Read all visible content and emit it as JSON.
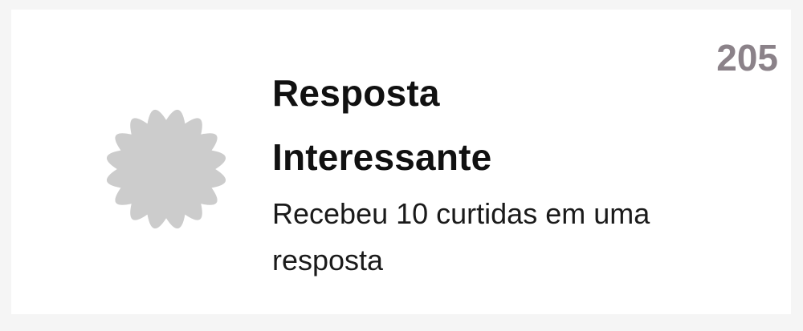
{
  "badge": {
    "icon": "badge-seal-icon",
    "icon_color": "#cccccc",
    "title": "Resposta Interessante",
    "description": "Recebeu 10 curtidas em uma resposta",
    "points": "205",
    "points_color": "#8b8289"
  }
}
